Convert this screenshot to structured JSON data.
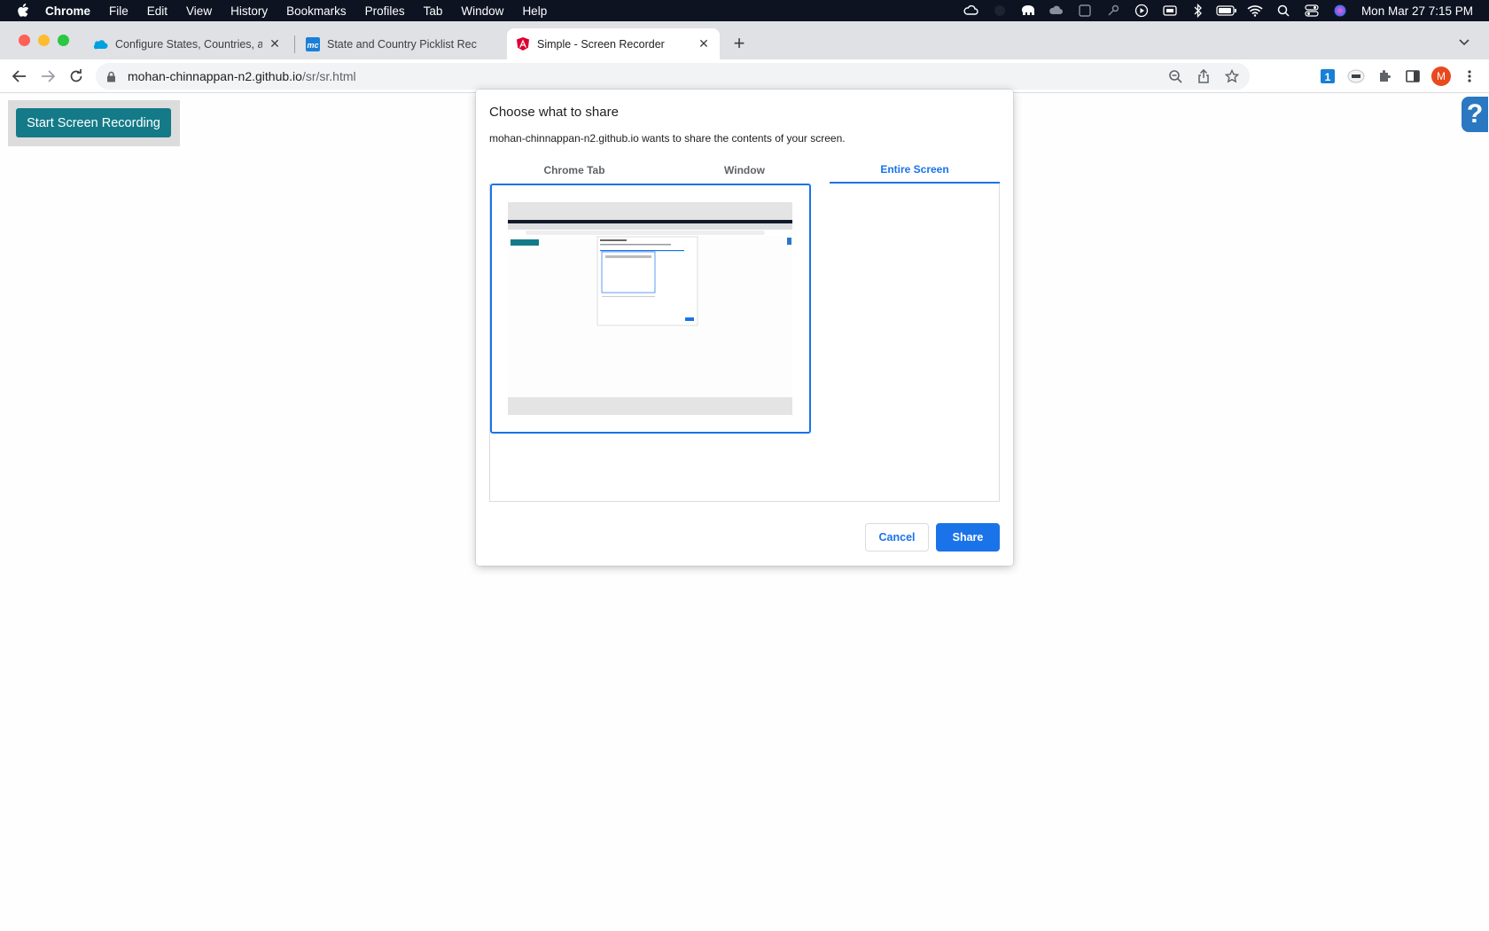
{
  "menubar": {
    "app_name": "Chrome",
    "items": [
      "File",
      "Edit",
      "View",
      "History",
      "Bookmarks",
      "Profiles",
      "Tab",
      "Window",
      "Help"
    ],
    "clock": "Mon Mar 27  7:15 PM"
  },
  "tabs": [
    {
      "title": "Configure States, Countries, ar",
      "favicon": "salesforce-cloud-icon",
      "active": false
    },
    {
      "title": "State and Country Picklist Rec",
      "favicon": "mc-icon",
      "active": false
    },
    {
      "title": "Simple - Screen Recorder",
      "favicon": "angular-icon",
      "active": true
    }
  ],
  "address": {
    "host": "mohan-chinnappan-n2.github.io",
    "path": "/sr/sr.html"
  },
  "profile": {
    "initial": "M"
  },
  "page": {
    "record_button": "Start Screen Recording",
    "help_label": "?"
  },
  "dialog": {
    "title": "Choose what to share",
    "description": "mohan-chinnappan-n2.github.io wants to share the contents of your screen.",
    "tabs": [
      "Chrome Tab",
      "Window",
      "Entire Screen"
    ],
    "active_tab": "Entire Screen",
    "cancel_label": "Cancel",
    "share_label": "Share"
  },
  "colors": {
    "accent": "#1a73e8",
    "record_button": "#147a88",
    "menubar": "#0d1321",
    "help": "#2b78c2"
  }
}
